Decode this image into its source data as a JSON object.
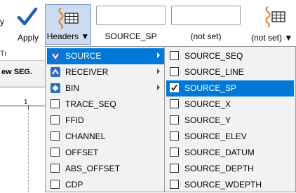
{
  "toolbar": {
    "partial_left_text": "y",
    "apply_label": "Apply",
    "headers_label": "Headers ▼",
    "field1_caption": "SOURCE_SP",
    "field2_caption": "(not set)",
    "headers2_label": "(not set) ▼",
    "group_label_partial": "Tr"
  },
  "background": {
    "header_text": "ew SEG.",
    "ruler_number": "1"
  },
  "menu": {
    "items": [
      {
        "label": "SOURCE",
        "icon": "source-arrow-icon",
        "submenu": true,
        "selected": true
      },
      {
        "label": "RECEIVER",
        "icon": "receiver-arrow-icon",
        "submenu": true,
        "selected": false
      },
      {
        "label": "BIN",
        "icon": "bin-diamond-icon",
        "submenu": true,
        "selected": false
      },
      {
        "label": "TRACE_SEQ",
        "checked": false
      },
      {
        "label": "FFID",
        "checked": false
      },
      {
        "label": "CHANNEL",
        "checked": false
      },
      {
        "label": "OFFSET",
        "checked": false
      },
      {
        "label": "ABS_OFFSET",
        "checked": false
      },
      {
        "label": "CDP",
        "checked": false
      }
    ]
  },
  "submenu": {
    "items": [
      {
        "label": "SOURCE_SEQ",
        "checked": false
      },
      {
        "label": "SOURCE_LINE",
        "checked": false
      },
      {
        "label": "SOURCE_SP",
        "checked": true,
        "selected": true
      },
      {
        "label": "SOURCE_X",
        "checked": false
      },
      {
        "label": "SOURCE_Y",
        "checked": false
      },
      {
        "label": "SOURCE_ELEV",
        "checked": false
      },
      {
        "label": "SOURCE_DATUM",
        "checked": false
      },
      {
        "label": "SOURCE_DEPTH",
        "checked": false
      },
      {
        "label": "SOURCE_WDEPTH",
        "checked": false
      }
    ]
  },
  "colors": {
    "selection": "#0078d7",
    "icon_blue": "#2b6cc4",
    "icon_orange": "#e8852a"
  }
}
